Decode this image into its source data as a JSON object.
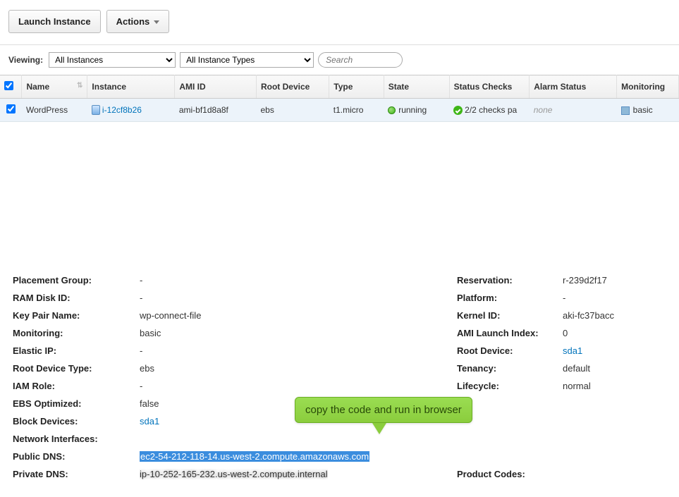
{
  "toolbar": {
    "launch_label": "Launch Instance",
    "actions_label": "Actions"
  },
  "filter": {
    "viewing_label": "Viewing:",
    "instances_filter": "All Instances",
    "types_filter": "All Instance Types",
    "search_placeholder": "Search"
  },
  "table": {
    "headers": {
      "name": "Name",
      "instance": "Instance",
      "ami": "AMI ID",
      "root": "Root Device",
      "type": "Type",
      "state": "State",
      "status": "Status Checks",
      "alarm": "Alarm Status",
      "monitoring": "Monitoring"
    },
    "row": {
      "name": "WordPress",
      "instance": "i-12cf8b26",
      "ami": "ami-bf1d8a8f",
      "root": "ebs",
      "type": "t1.micro",
      "state": "running",
      "status": "2/2 checks pa",
      "alarm": "none",
      "monitoring": "basic"
    }
  },
  "details": {
    "left": {
      "placement_group": {
        "k": "Placement Group:",
        "v": "-"
      },
      "ram_disk": {
        "k": "RAM Disk ID:",
        "v": "-"
      },
      "key_pair": {
        "k": "Key Pair Name:",
        "v": "wp-connect-file"
      },
      "monitoring": {
        "k": "Monitoring:",
        "v": "basic"
      },
      "elastic_ip": {
        "k": "Elastic IP:",
        "v": "-"
      },
      "root_device_type": {
        "k": "Root Device Type:",
        "v": "ebs"
      },
      "iam_role": {
        "k": "IAM Role:",
        "v": "-"
      },
      "ebs_optimized": {
        "k": "EBS Optimized:",
        "v": "false"
      },
      "block_devices": {
        "k": "Block Devices:",
        "v": "sda1"
      },
      "network_if": {
        "k": "Network Interfaces:",
        "v": ""
      },
      "public_dns": {
        "k": "Public DNS:",
        "v": "ec2-54-212-118-14.us-west-2.compute.amazonaws.com"
      },
      "private_dns": {
        "k": "Private DNS:",
        "v": "ip-10-252-165-232.us-west-2.compute.internal"
      }
    },
    "right": {
      "reservation": {
        "k": "Reservation:",
        "v": "r-239d2f17"
      },
      "platform": {
        "k": "Platform:",
        "v": "-"
      },
      "kernel": {
        "k": "Kernel ID:",
        "v": "aki-fc37bacc"
      },
      "ami_launch": {
        "k": "AMI Launch Index:",
        "v": "0"
      },
      "root_device": {
        "k": "Root Device:",
        "v": "sda1"
      },
      "tenancy": {
        "k": "Tenancy:",
        "v": "default"
      },
      "lifecycle": {
        "k": "Lifecycle:",
        "v": "normal"
      },
      "product_codes": {
        "k": "Product Codes:",
        "v": ""
      }
    }
  },
  "callout": {
    "text": "copy the code and run in browser"
  }
}
